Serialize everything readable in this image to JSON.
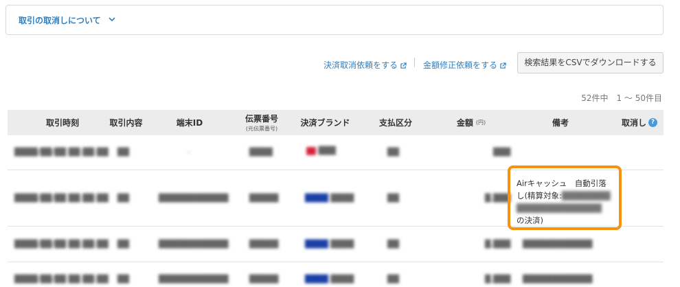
{
  "accordion": {
    "title": "取引の取消しについて"
  },
  "toolbar": {
    "cancel_request": "決済取消依頼をする",
    "amount_fix_request": "金額修正依頼をする",
    "csv_button": "検索結果をCSVでダウンロードする"
  },
  "result_count": "52件中　1 ～ 50件目",
  "table": {
    "headers": {
      "time": "取引時刻",
      "content": "取引内容",
      "terminal": "端末ID",
      "slip": "伝票番号",
      "slip_sub": "(元伝票番号)",
      "brand": "決済ブランド",
      "payment": "支払区分",
      "amount": "金額",
      "amount_unit": "(円)",
      "remarks": "備考",
      "cancel": "取消し"
    },
    "note_line1": "Airキャッシュ　自動引落",
    "note_line2": "し(精算対象:",
    "note_line3": "の決済)"
  },
  "colors": {
    "link": "#2f7fc1",
    "highlight": "#f7930a"
  }
}
